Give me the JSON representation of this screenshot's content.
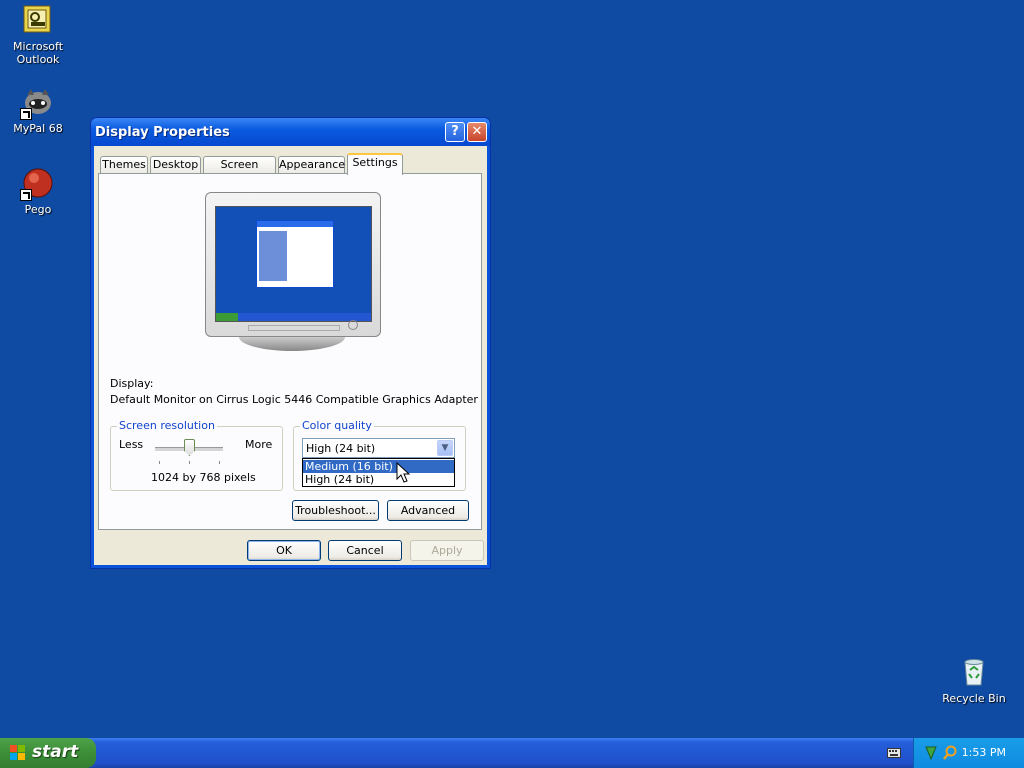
{
  "desktop": {
    "icons": [
      {
        "label": "Microsoft\nOutlook"
      },
      {
        "label": "MyPal 68"
      },
      {
        "label": "Pego"
      },
      {
        "label": "Recycle Bin"
      }
    ]
  },
  "window": {
    "title": "Display Properties",
    "help_glyph": "?",
    "close_glyph": "✕",
    "tabs": [
      {
        "label": "Themes"
      },
      {
        "label": "Desktop"
      },
      {
        "label": "Screen Saver"
      },
      {
        "label": "Appearance"
      },
      {
        "label": "Settings"
      }
    ],
    "active_tab": "Settings",
    "display_label": "Display:",
    "display_value": "Default Monitor on Cirrus Logic 5446 Compatible Graphics Adapter",
    "resolution": {
      "legend": "Screen resolution",
      "less": "Less",
      "more": "More",
      "value_text": "1024 by 768 pixels"
    },
    "color_quality": {
      "legend": "Color quality",
      "selected": "High (24 bit)",
      "options": [
        {
          "label": "Medium (16 bit)",
          "highlighted": true
        },
        {
          "label": "High (24 bit)",
          "highlighted": false
        }
      ]
    },
    "troubleshoot_label": "Troubleshoot...",
    "advanced_label": "Advanced",
    "ok_label": "OK",
    "cancel_label": "Cancel",
    "apply_label": "Apply"
  },
  "taskbar": {
    "start_label": "start",
    "clock": "1:53 PM"
  },
  "colors": {
    "desktop": "#0f4ba3",
    "selection": "#316ac5",
    "start_green": "#3c8e37"
  }
}
